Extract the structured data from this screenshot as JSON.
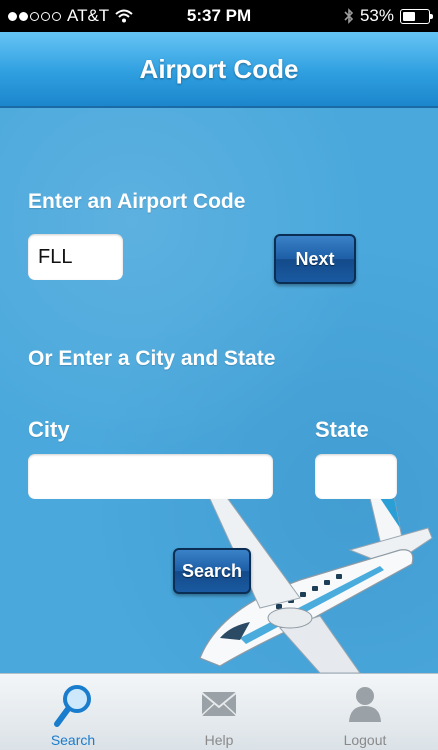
{
  "status_bar": {
    "carrier": "AT&T",
    "time": "5:37 PM",
    "battery_percent_label": "53%",
    "battery_level": 0.53,
    "signal_bars": 2
  },
  "nav": {
    "title": "Airport Code"
  },
  "form": {
    "airport_code_label": "Enter an Airport Code",
    "airport_code_value": "FLL",
    "next_label": "Next",
    "city_state_label": "Or Enter a City and State",
    "city_label": "City",
    "city_value": "",
    "state_label": "State",
    "state_value": "",
    "search_label": "Search"
  },
  "tabs": [
    {
      "label": "Search",
      "icon": "magnifier-icon",
      "active": true
    },
    {
      "label": "Help",
      "icon": "envelope-icon",
      "active": false
    },
    {
      "label": "Logout",
      "icon": "person-icon",
      "active": false
    }
  ],
  "colors": {
    "nav_blue": "#2f9fe0",
    "background_blue": "#4aa8dc",
    "button_blue": "#1d5ea6",
    "active_tab": "#1a7ccc"
  }
}
